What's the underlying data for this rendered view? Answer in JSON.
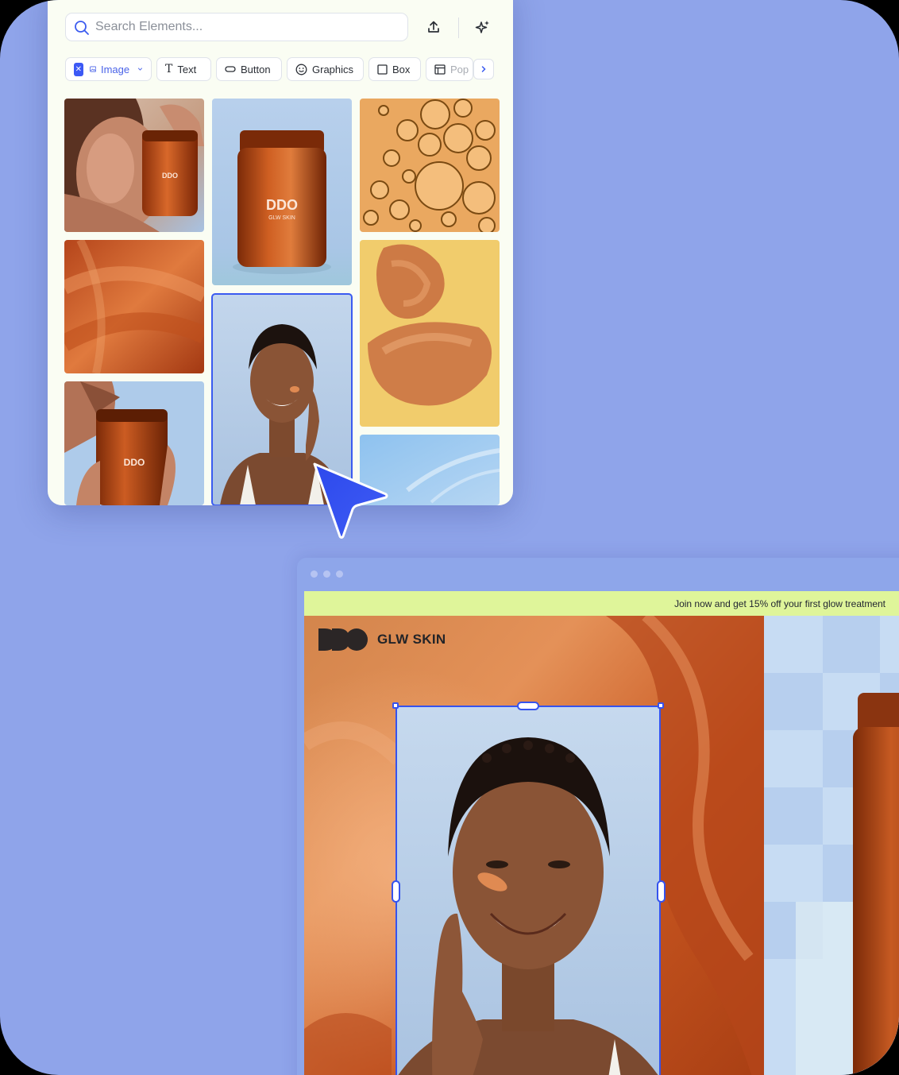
{
  "panel": {
    "search_placeholder": "Search Elements...",
    "icons": [
      "search-icon",
      "upload-icon",
      "ai-sparkle-icon"
    ],
    "filters": [
      {
        "label": "Image",
        "icon": "image-icon",
        "active": true
      },
      {
        "label": "Text",
        "icon": "text-icon",
        "active": false
      },
      {
        "label": "Button",
        "icon": "button-icon",
        "active": false
      },
      {
        "label": "Graphics",
        "icon": "smiley-icon",
        "active": false
      },
      {
        "label": "Box",
        "icon": "box-icon",
        "active": false
      },
      {
        "label": "Pop",
        "icon": "popup-icon",
        "active": false
      }
    ],
    "thumbnails": [
      "model-holding-jar",
      "amber-jar-product",
      "oil-bubbles",
      "orange-texture",
      "cream-swatches",
      "model-smiling-selected",
      "model-with-jar",
      "sky"
    ],
    "product_logo_text": "GLW SKIN"
  },
  "editor": {
    "promo_text": "Join now and get 15% off your first glow treatment",
    "brand_name": "GLW SKIN"
  },
  "colors": {
    "background": "#8fa4ea",
    "accent": "#3a5bf0",
    "promo_bar": "#dff59a",
    "amber": "#c2541c"
  }
}
